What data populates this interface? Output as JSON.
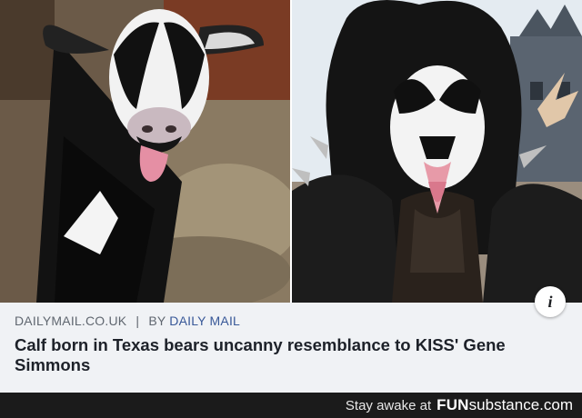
{
  "post": {
    "source_domain": "DAILYMAIL.CO.UK",
    "separator": "|",
    "by_prefix": "BY",
    "author": "DAILY MAIL",
    "headline": "Calf born in Texas bears uncanny resemblance to KISS' Gene Simmons",
    "info_icon": "info-icon",
    "info_glyph": "i"
  },
  "footer": {
    "tagline": "Stay awake at",
    "brand_bold": "FUN",
    "brand_regular": "substance.com"
  },
  "colors": {
    "page_background": "#ffffff",
    "card_background": "#f0f2f5",
    "meta_text": "#606770",
    "author_link": "#385898",
    "headline_text": "#1d2129",
    "footer_background": "#1b1b1b"
  }
}
